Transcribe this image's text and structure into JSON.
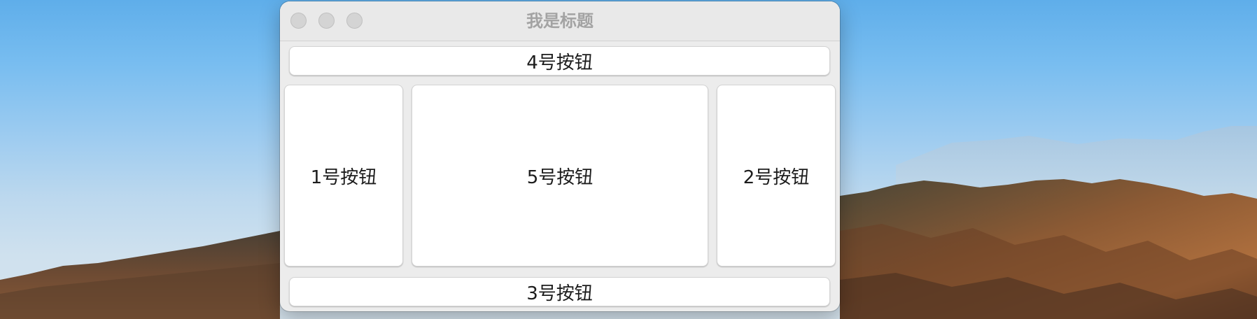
{
  "window": {
    "title": "我是标题"
  },
  "buttons": {
    "button_4": "4号按钮",
    "button_1": "1号按钮",
    "button_5": "5号按钮",
    "button_2": "2号按钮",
    "button_3": "3号按钮"
  },
  "colors": {
    "window_bg": "#ececec",
    "titlebar_bg": "#e9e9e9",
    "title_text": "#a3a3a3",
    "traffic_light_inactive": "#d4d4d4",
    "button_bg": "#ffffff",
    "sky": "#78bdf0",
    "mountain": "#7a4a2e"
  }
}
